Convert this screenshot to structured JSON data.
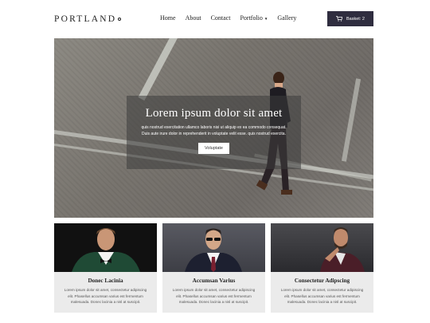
{
  "header": {
    "logo": "PORTLAND",
    "nav": [
      "Home",
      "About",
      "Contact",
      "Portfolio",
      "Gallery"
    ],
    "basket_label": "Basket: 2"
  },
  "hero": {
    "title": "Lorem ipsum dolor sit amet",
    "text": "quis nostrud exercitation ullamco laboris nisi ut aliquip ex ea commodo consequat. Duis aute irure dolor in reprehenderit in voluptate velit esse. quis nostrud exercita.",
    "button": "Voluptate"
  },
  "cards": [
    {
      "title": "Donec Lacinia",
      "text": "Lorem ipsum dolor sit amet, consectetur adipiscing elit. Phasellus accumsan varius est fermentum malesuada. Donec lacinia a nisl at suscipit."
    },
    {
      "title": "Accumsan Varius",
      "text": "Lorem ipsum dolor sit amet, consectetur adipiscing elit. Phasellus accumsan varius est fermentum malesuada. Donec lacinia a nisl at suscipit."
    },
    {
      "title": "Consectetur Adipscing",
      "text": "Lorem ipsum dolor sit amet, consectetur adipiscing elit. Phasellus accumsan varius est fermentum malesuada. Donec lacinia a nisl at suscipit."
    }
  ],
  "colors": {
    "basket_bg": "#2f2d3f",
    "card_bg": "#ebebeb"
  },
  "icons": {
    "basket": "cart-icon",
    "portfolio": "caret-down-icon"
  }
}
